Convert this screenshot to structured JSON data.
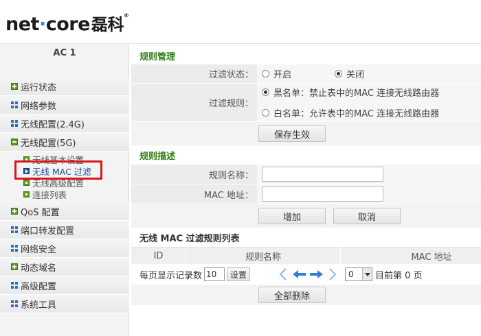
{
  "brand": {
    "logo_left": "net",
    "logo_right": "core",
    "logo_cn": "磊科",
    "registered": "®"
  },
  "sidebar": {
    "device": "AC 1",
    "items": [
      {
        "label": "运行状态",
        "icon": "plus-icon"
      },
      {
        "label": "网络参数",
        "icon": "grid-icon"
      },
      {
        "label": "无线配置(2.4G)",
        "icon": "grid-icon"
      },
      {
        "label": "无线配置(5G)",
        "icon": "minus-icon"
      }
    ],
    "sub_items": [
      {
        "label": "无线基本设置"
      },
      {
        "label": "无线 MAC 过滤"
      },
      {
        "label": "无线高级配置"
      },
      {
        "label": "连接列表"
      }
    ],
    "items_after": [
      {
        "label": "QoS 配置",
        "icon": "plus-icon"
      },
      {
        "label": "端口转发配置",
        "icon": "grid-icon"
      },
      {
        "label": "网络安全",
        "icon": "grid-icon"
      },
      {
        "label": "动态域名",
        "icon": "plus-icon"
      },
      {
        "label": "高级配置",
        "icon": "grid-icon"
      },
      {
        "label": "系统工具",
        "icon": "grid-icon"
      }
    ]
  },
  "rules_mgmt": {
    "title": "规则管理",
    "filter_status_label": "过滤状态：",
    "on_label": "开启",
    "off_label": "关闭",
    "filter_status_selected": "关闭",
    "filter_rule_label": "过滤规则：",
    "blacklist_label": "黑名单：禁止表中的MAC 连接无线路由器",
    "whitelist_label": "白名单：允许表中的MAC 连接无线路由器",
    "filter_rule_selected": "黑名单",
    "save_button": "保存生效"
  },
  "rule_desc": {
    "title": "规则描述",
    "name_label": "规则名称：",
    "name_value": "",
    "mac_label": "MAC 地址：",
    "mac_value": "",
    "add_button": "增加",
    "cancel_button": "取消"
  },
  "rule_list": {
    "title": "无线 MAC 过滤规则列表",
    "columns": [
      "ID",
      "规则名称",
      "MAC 地址"
    ],
    "per_page_label": "每页显示记录数",
    "per_page_value": "10",
    "set_button": "设置",
    "page_select_value": "0",
    "current_page_text": "目前第 0 页",
    "delete_all_button": "全部删除"
  },
  "colors": {
    "section_title": "#2e7d10",
    "highlight_box": "#d9171b",
    "logo_dot": "#2b8fd6"
  }
}
